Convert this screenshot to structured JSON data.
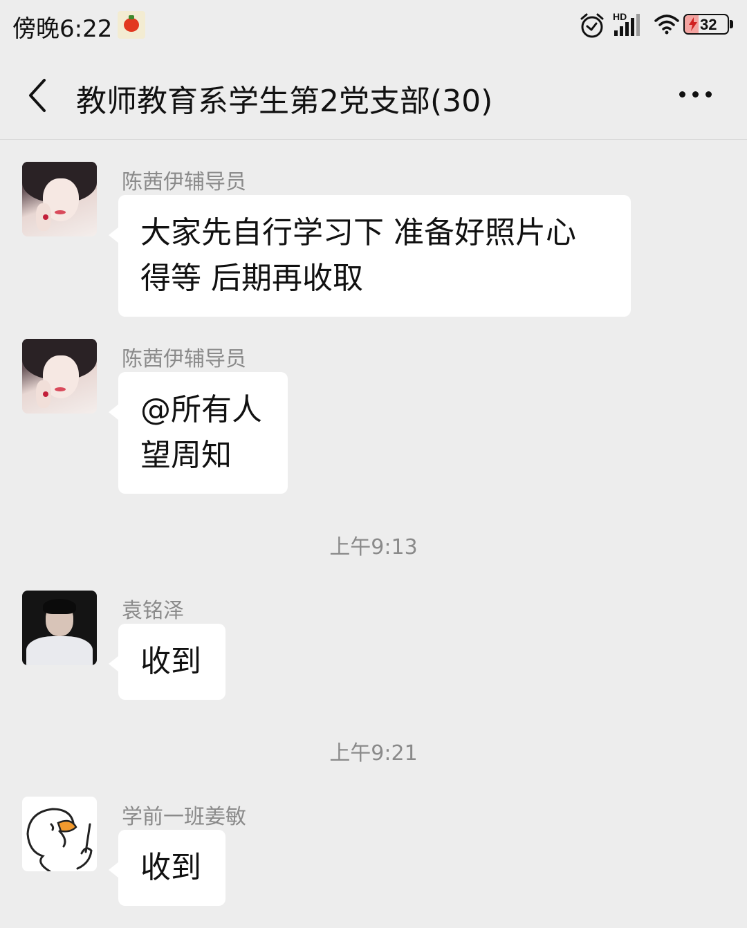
{
  "status_bar": {
    "time": "傍晚6:22",
    "battery_level": "32",
    "network": "HD",
    "icons": [
      "tomato-app-icon",
      "alarm-icon",
      "hd-signal-icon",
      "wifi-icon",
      "battery-charging-icon"
    ]
  },
  "header": {
    "title": "教师教育系学生第2党支部(30)",
    "back_icon": "chevron-left-icon",
    "more_icon": "more-dots-icon"
  },
  "messages": [
    {
      "type": "message",
      "sender": "陈茜伊辅导员",
      "lines": [
        "大家先自行学习下 准备好照片心",
        "得等 后期再收取"
      ],
      "avatar": "girl-avatar"
    },
    {
      "type": "message",
      "sender": "陈茜伊辅导员",
      "lines": [
        "@所有人",
        "望周知"
      ],
      "avatar": "girl-avatar"
    },
    {
      "type": "time",
      "text": "上午9:13"
    },
    {
      "type": "message",
      "sender": "袁铭泽",
      "lines": [
        "收到"
      ],
      "avatar": "boy-avatar"
    },
    {
      "type": "time",
      "text": "上午9:21"
    },
    {
      "type": "message",
      "sender": "学前一班姜敏",
      "lines": [
        "收到"
      ],
      "avatar": "duck-avatar"
    }
  ],
  "colors": {
    "background": "#ededed",
    "bubble": "#ffffff",
    "meta_text": "#8a8a8a",
    "battery_fill": "#f3a3a0"
  }
}
